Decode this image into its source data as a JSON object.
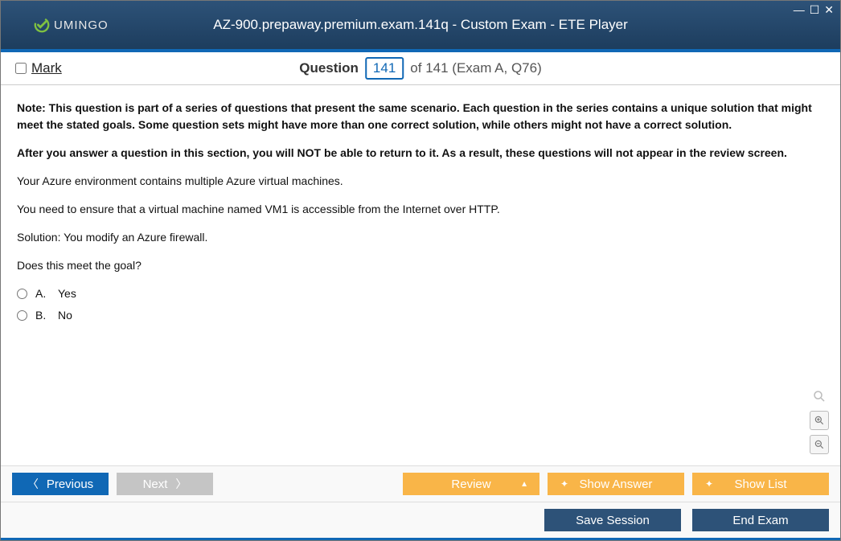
{
  "window": {
    "title": "AZ-900.prepaway.premium.exam.141q - Custom Exam - ETE Player",
    "logo_text": "UMINGO"
  },
  "header": {
    "mark_label": "Mark",
    "question_label": "Question",
    "current_num": "141",
    "of_text": "of 141 (Exam A, Q76)"
  },
  "body": {
    "note1": "Note: This question is part of a series of questions that present the same scenario. Each question in the series contains a unique solution that might meet the stated goals. Some question sets might have more than one correct solution, while others might not have a correct solution.",
    "note2": "After you answer a question in this section, you will NOT be able to return to it. As a result, these questions will not appear in the review screen.",
    "line1": "Your Azure environment contains multiple Azure virtual machines.",
    "line2": "You need to ensure that a virtual machine named VM1 is accessible from the Internet over HTTP.",
    "line3": "Solution: You modify an Azure firewall.",
    "line4": "Does this meet the goal?",
    "options": [
      {
        "letter": "A.",
        "text": "Yes"
      },
      {
        "letter": "B.",
        "text": "No"
      }
    ]
  },
  "buttons": {
    "previous": "Previous",
    "next": "Next",
    "review": "Review",
    "show_answer": "Show Answer",
    "show_list": "Show List",
    "save_session": "Save Session",
    "end_exam": "End Exam"
  }
}
